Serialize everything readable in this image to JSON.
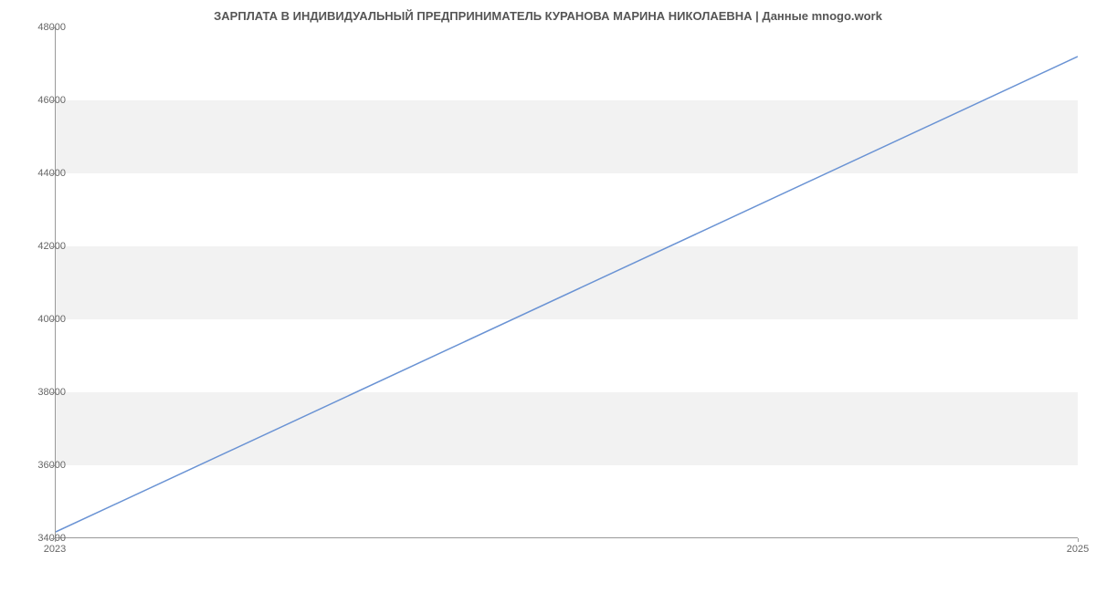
{
  "chart_data": {
    "type": "line",
    "title": "ЗАРПЛАТА В ИНДИВИДУАЛЬНЫЙ ПРЕДПРИНИМАТЕЛЬ КУРАНОВА МАРИНА НИКОЛАЕВНА | Данные mnogo.work",
    "x": [
      2023,
      2025
    ],
    "values": [
      34150,
      47200
    ],
    "xlabel": "",
    "ylabel": "",
    "x_ticks": [
      2023,
      2025
    ],
    "y_ticks": [
      34000,
      36000,
      38000,
      40000,
      42000,
      44000,
      46000,
      48000
    ],
    "ylim": [
      34000,
      48000
    ],
    "xlim": [
      2023,
      2025
    ],
    "line_color": "#6a93d4",
    "grid_band_color": "#f2f2f2"
  }
}
